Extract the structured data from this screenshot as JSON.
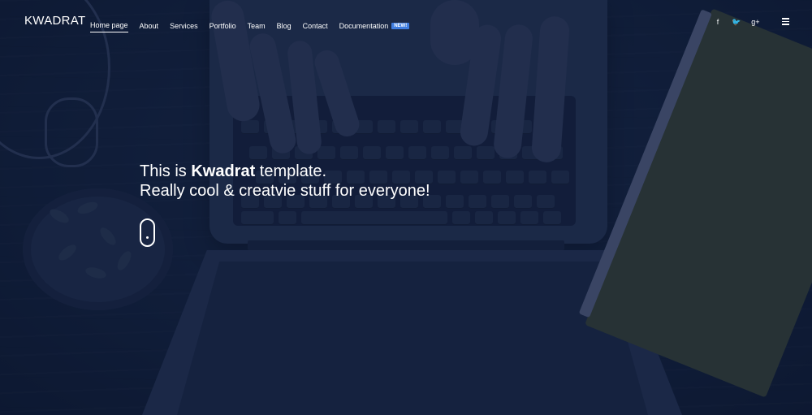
{
  "brand": {
    "logo": "KWADRAT"
  },
  "nav": {
    "items": [
      {
        "label": "Home page",
        "active": true
      },
      {
        "label": "About"
      },
      {
        "label": "Services"
      },
      {
        "label": "Portfolio"
      },
      {
        "label": "Team"
      },
      {
        "label": "Blog"
      },
      {
        "label": "Contact"
      },
      {
        "label": "Documentation",
        "badge": "NEW!"
      }
    ]
  },
  "social": {
    "facebook": "f",
    "twitter": "🐦",
    "googleplus": "g+"
  },
  "hero": {
    "line1_prefix": "This is ",
    "line1_brand": "Kwadrat",
    "line1_suffix": " template.",
    "line2": "Really cool & creatvie stuff for everyone!"
  },
  "colors": {
    "overlay": "#0e1c3a",
    "badge": "#3f7de0",
    "text": "#ffffff"
  },
  "icons": {
    "menu": "hamburger-icon",
    "scroll": "mouse-scroll-icon"
  }
}
